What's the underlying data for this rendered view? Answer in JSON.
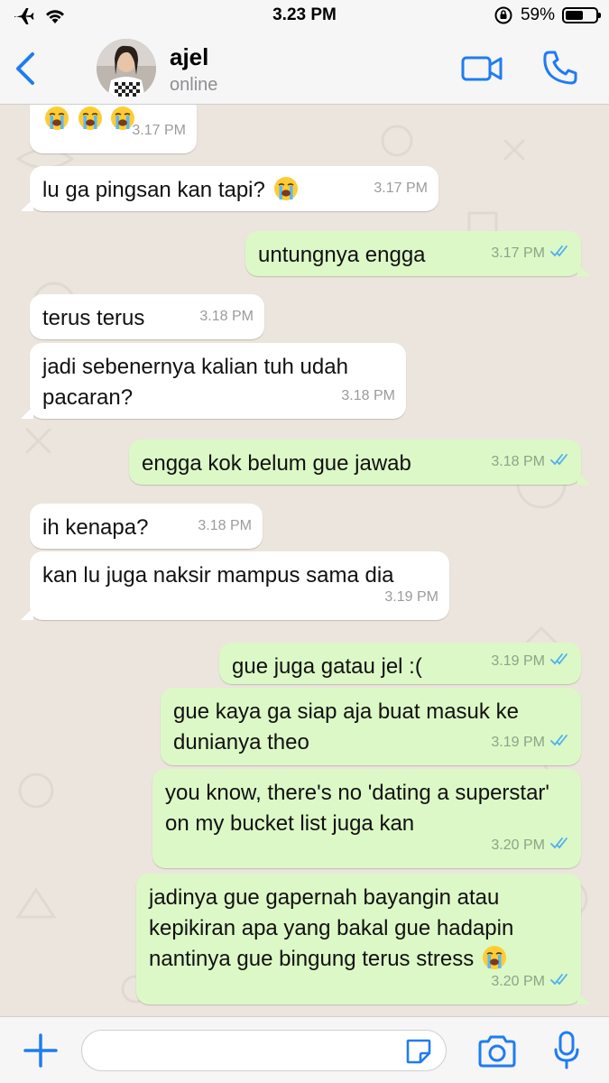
{
  "status_bar": {
    "time": "3.23 PM",
    "battery_percent": "59%",
    "battery_level": 0.59
  },
  "header": {
    "contact_name": "ajel",
    "contact_status": "online"
  },
  "colors": {
    "accent": "#1f7cf2",
    "outgoing_bubble": "#dcf8c6",
    "incoming_bubble": "#ffffff",
    "chat_background": "#ece5dd",
    "read_ticks": "#4fb0f0"
  },
  "messages": [
    {
      "direction": "in",
      "text": "",
      "emoji": [
        "loudly-crying-face",
        "loudly-crying-face",
        "loudly-crying-face"
      ],
      "time": "3.17 PM"
    },
    {
      "direction": "in",
      "text": "lu ga pingsan kan tapi?",
      "emoji": [
        "loudly-crying-face"
      ],
      "time": "3.17 PM"
    },
    {
      "direction": "out",
      "text": "untungnya engga",
      "time": "3.17 PM",
      "read": true
    },
    {
      "direction": "in",
      "text": "terus terus",
      "time": "3.18 PM"
    },
    {
      "direction": "in",
      "text": "jadi sebenernya kalian tuh udah pacaran?",
      "time": "3.18 PM"
    },
    {
      "direction": "out",
      "text": "engga kok belum gue jawab",
      "time": "3.18 PM",
      "read": true
    },
    {
      "direction": "in",
      "text": "ih kenapa?",
      "time": "3.18 PM"
    },
    {
      "direction": "in",
      "text": "kan lu juga naksir mampus sama dia",
      "time": "3.19 PM"
    },
    {
      "direction": "out",
      "text": "gue juga gatau jel :(",
      "time": "3.19 PM",
      "read": true
    },
    {
      "direction": "out",
      "text": "gue kaya ga siap aja buat masuk ke dunianya theo",
      "time": "3.19 PM",
      "read": true
    },
    {
      "direction": "out",
      "text": "you know, there's no 'dating a superstar' on my bucket list juga kan",
      "time": "3.20 PM",
      "read": true
    },
    {
      "direction": "out",
      "text": "jadinya gue gapernah bayangin atau kepikiran apa yang bakal gue hadapin nantinya gue bingung terus stress",
      "emoji": [
        "loudly-crying-face"
      ],
      "time": "3.20 PM",
      "read": true
    }
  ],
  "input": {
    "value": "",
    "placeholder": ""
  },
  "icons": {
    "back": "chevron-left-icon",
    "video": "video-camera-icon",
    "call": "phone-icon",
    "plus": "plus-icon",
    "sticker": "sticker-icon",
    "camera": "camera-icon",
    "mic": "microphone-icon"
  }
}
